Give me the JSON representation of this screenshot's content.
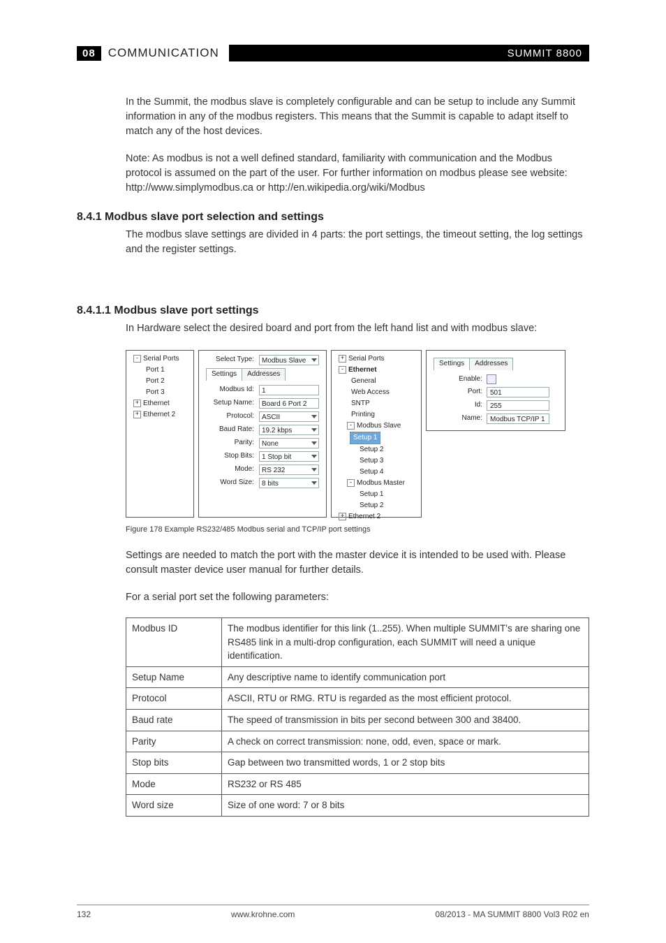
{
  "header": {
    "section_num": "08",
    "section_title": "COMMUNICATION",
    "product": "SUMMIT 8800"
  },
  "intro": {
    "p1": "In the Summit, the modbus slave is completely configurable and can be setup to include any Summit information in any of the modbus registers. This means that the Summit is capable to adapt itself to match any of the host devices.",
    "p2": "Note: As modbus is not a well defined standard, familiarity with communication and the Modbus protocol is assumed on the part of the user. For further information on modbus please see website: http://www.simplymodbus.ca or http://en.wikipedia.org/wiki/Modbus"
  },
  "sec841": {
    "heading": "8.4.1 Modbus slave port selection and settings",
    "p": "The modbus slave settings are divided in 4 parts: the port settings, the timeout setting, the log settings and the register settings."
  },
  "sec8411": {
    "heading": "8.4.1.1 Modbus slave port settings",
    "p": "In Hardware select the desired board and port from the left hand list and with modbus slave:"
  },
  "shot1": {
    "tree": {
      "root": "Serial Ports",
      "p1": "Port 1",
      "p2": "Port 2",
      "p3": "Port 3",
      "e1": "Ethernet",
      "e2": "Ethernet 2"
    },
    "form": {
      "select_type_lbl": "Select Type:",
      "select_type": "Modbus Slave",
      "tab_settings": "Settings",
      "tab_addresses": "Addresses",
      "modbus_id_lbl": "Modbus Id:",
      "modbus_id": "1",
      "setup_name_lbl": "Setup Name:",
      "setup_name": "Board 6 Port 2",
      "protocol_lbl": "Protocol:",
      "protocol": "ASCII",
      "baud_lbl": "Baud Rate:",
      "baud": "19.2 kbps",
      "parity_lbl": "Parity:",
      "parity": "None",
      "stop_lbl": "Stop Bits:",
      "stop": "1 Stop bit",
      "mode_lbl": "Mode:",
      "mode": "RS 232",
      "word_lbl": "Word Size:",
      "word": "8 bits"
    }
  },
  "shot2": {
    "tree": {
      "sp": "Serial Ports",
      "eth": "Ethernet",
      "gen": "General",
      "web": "Web Access",
      "sntp": "SNTP",
      "print": "Printing",
      "ms": "Modbus Slave",
      "s1": "Setup 1",
      "s2": "Setup 2",
      "s3": "Setup 3",
      "s4": "Setup 4",
      "mm": "Modbus Master",
      "mm1": "Setup 1",
      "mm2": "Setup 2",
      "e2": "Ethernet 2"
    },
    "form": {
      "tab_settings": "Settings",
      "tab_addresses": "Addresses",
      "enable_lbl": "Enable:",
      "port_lbl": "Port:",
      "port": "501",
      "id_lbl": "Id:",
      "id": "255",
      "name_lbl": "Name:",
      "name": "Modbus TCP/IP 1"
    }
  },
  "figcap": "Figure 178    Example RS232/485 Modbus serial and TCP/IP port settings",
  "after_fig": {
    "p1": "Settings are needed to match the port with the master device it is intended to be used with. Please consult master device user manual for further details.",
    "p2": "For a serial port set the following parameters:"
  },
  "table": [
    {
      "name": "Modbus ID",
      "desc": "The modbus identifier for this link (1..255). When multiple SUMMIT's are sharing one RS485 link in a multi-drop configuration, each SUMMIT will need a unique identification."
    },
    {
      "name": "Setup Name",
      "desc": "Any descriptive name to identify communication port"
    },
    {
      "name": "Protocol",
      "desc": "ASCII, RTU or RMG. RTU is regarded as the most efficient protocol."
    },
    {
      "name": "Baud rate",
      "desc": "The speed of transmission in bits per second between 300 and 38400."
    },
    {
      "name": "Parity",
      "desc": "A check on correct transmission: none, odd, even, space or mark."
    },
    {
      "name": "Stop bits",
      "desc": "Gap between two transmitted words, 1 or 2 stop bits"
    },
    {
      "name": "Mode",
      "desc": "RS232 or RS 485"
    },
    {
      "name": "Word size",
      "desc": "Size of one word: 7 or 8 bits"
    }
  ],
  "footer": {
    "page": "132",
    "site": "www.krohne.com",
    "doc": "08/2013 - MA SUMMIT 8800 Vol3 R02 en"
  }
}
